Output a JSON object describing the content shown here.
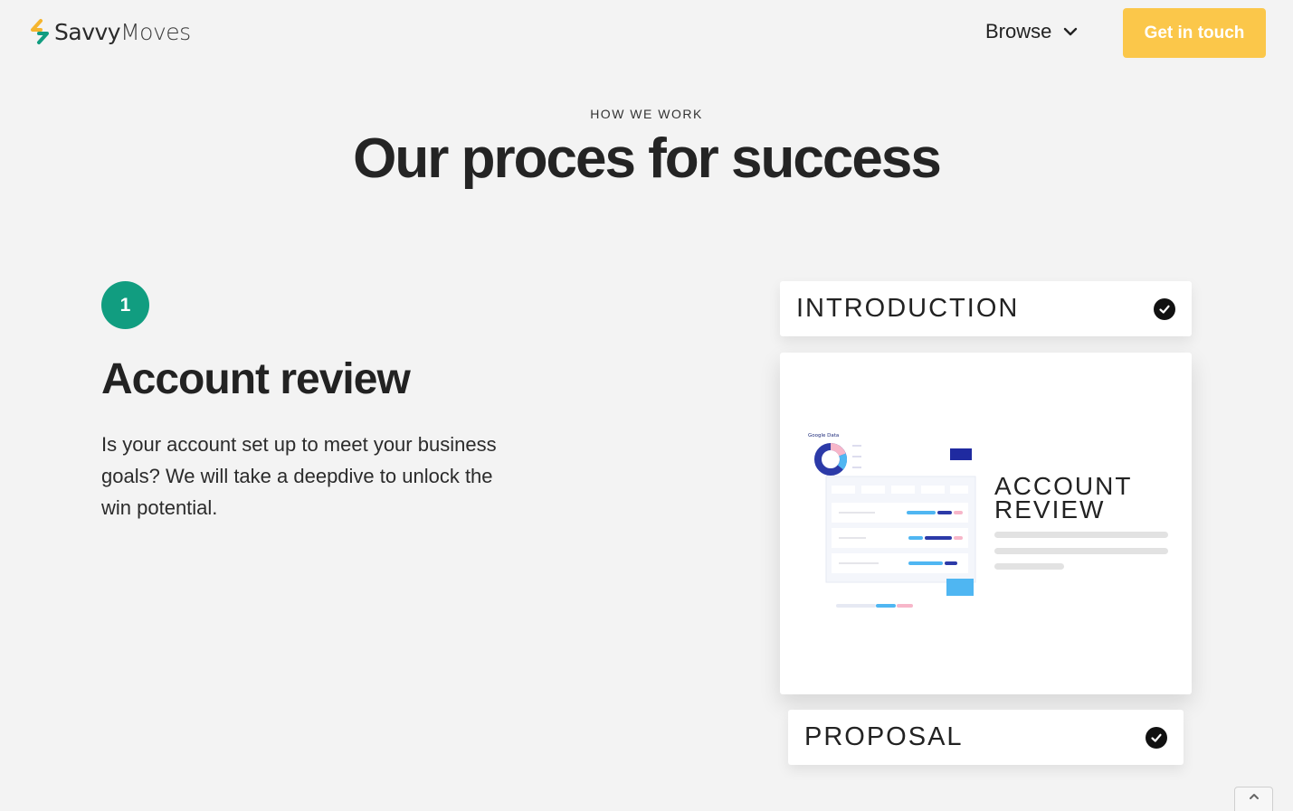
{
  "header": {
    "logo_primary": "Savvy",
    "logo_secondary": "Moves",
    "browse_label": "Browse",
    "cta_label": "Get in touch"
  },
  "section": {
    "eyebrow": "HOW WE WORK",
    "title": "Our proces for success"
  },
  "step": {
    "number": "1",
    "title": "Account review",
    "description": "Is your account set up to meet your business goals? We will take a deepdive to unlock the win potential."
  },
  "cards": {
    "intro_label": "INTRODUCTION",
    "main_heading_line1": "ACCOUNT",
    "main_heading_line2": "REVIEW",
    "proposal_label": "PROPOSAL",
    "illustration_caption": "Google Data"
  },
  "colors": {
    "accent_yellow": "#fbc74a",
    "accent_green": "#119d80",
    "background": "#f3f3f3"
  },
  "icons": {
    "logo": "chevron-logo-icon",
    "browse": "chevron-down-icon",
    "check": "check-circle-icon",
    "scroll_top": "chevron-up-icon"
  }
}
